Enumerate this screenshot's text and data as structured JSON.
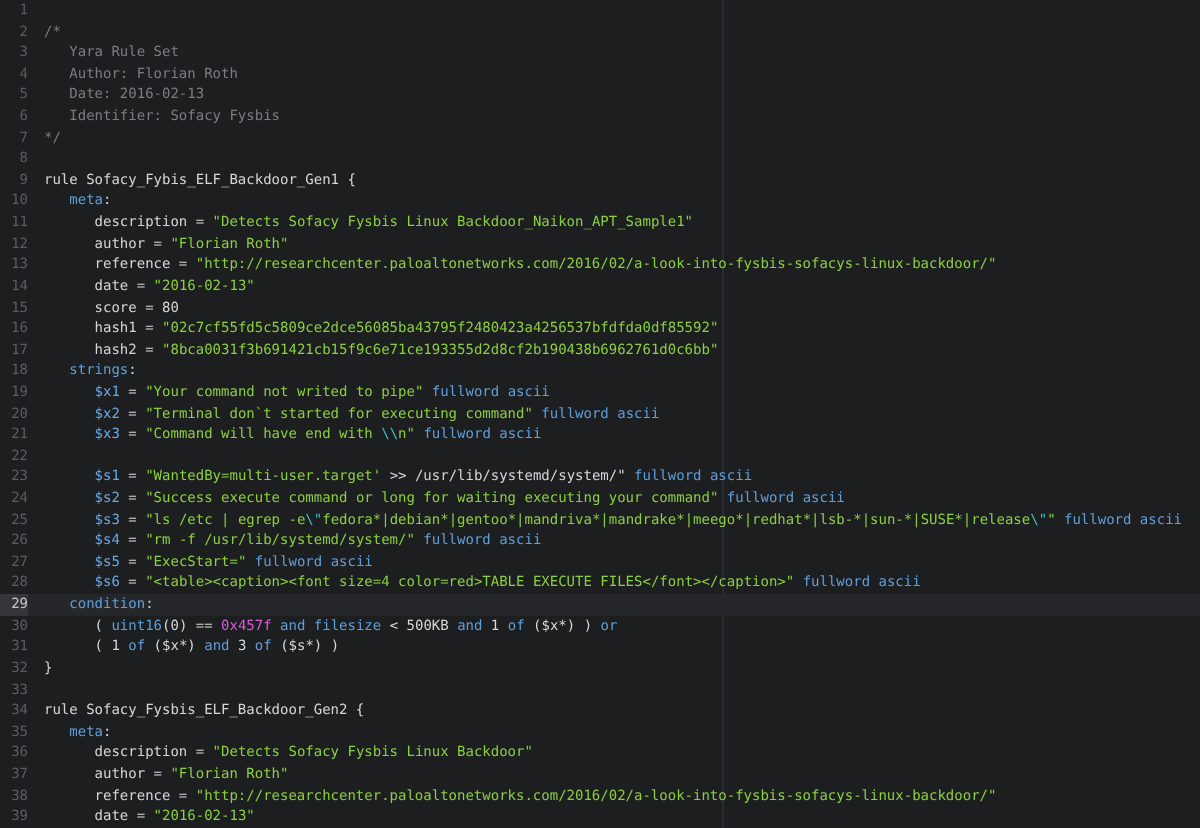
{
  "editor": {
    "lines": [
      {
        "number": "1",
        "selected": false
      },
      {
        "number": "2",
        "selected": false,
        "tokens": [
          {
            "kind": "comment",
            "text": "/*"
          }
        ]
      },
      {
        "number": "3",
        "selected": false,
        "tokens": [
          {
            "kind": "comment",
            "text": "   Yara Rule Set"
          }
        ]
      },
      {
        "number": "4",
        "selected": false,
        "tokens": [
          {
            "kind": "comment",
            "text": "   Author: Florian Roth"
          }
        ]
      },
      {
        "number": "5",
        "selected": false,
        "tokens": [
          {
            "kind": "comment",
            "text": "   Date: 2016-02-13"
          }
        ]
      },
      {
        "number": "6",
        "selected": false,
        "tokens": [
          {
            "kind": "comment",
            "text": "   Identifier: Sofacy Fysbis"
          }
        ]
      },
      {
        "number": "7",
        "selected": false,
        "tokens": [
          {
            "kind": "comment",
            "text": "*/"
          }
        ]
      },
      {
        "number": "8",
        "selected": false
      },
      {
        "number": "9",
        "selected": false,
        "tokens": [
          {
            "kind": "plain",
            "text": "rule Sofacy_Fybis_ELF_Backdoor_Gen1 {"
          }
        ]
      },
      {
        "number": "10",
        "selected": false,
        "tokens": [
          {
            "kind": "keyword",
            "text": "   meta"
          },
          {
            "kind": "plain",
            "text": ":"
          }
        ]
      },
      {
        "number": "11",
        "selected": false,
        "tokens": [
          {
            "kind": "plain",
            "text": "      description = "
          },
          {
            "kind": "string",
            "text": "\"Detects Sofacy Fysbis Linux Backdoor_Naikon_APT_Sample1\""
          }
        ]
      },
      {
        "number": "12",
        "selected": false,
        "tokens": [
          {
            "kind": "plain",
            "text": "      author = "
          },
          {
            "kind": "string",
            "text": "\"Florian Roth\""
          }
        ]
      },
      {
        "number": "13",
        "selected": false,
        "tokens": [
          {
            "kind": "plain",
            "text": "      reference = "
          },
          {
            "kind": "string",
            "text": "\"http://researchcenter.paloaltonetworks.com/2016/02/a-look-into-fysbis-sofacys-linux-backdoor/\""
          }
        ]
      },
      {
        "number": "14",
        "selected": false,
        "tokens": [
          {
            "kind": "plain",
            "text": "      date = "
          },
          {
            "kind": "string",
            "text": "\"2016-02-13\""
          }
        ]
      },
      {
        "number": "15",
        "selected": false,
        "tokens": [
          {
            "kind": "plain",
            "text": "      score = 80"
          }
        ]
      },
      {
        "number": "16",
        "selected": false,
        "tokens": [
          {
            "kind": "plain",
            "text": "      hash1 = "
          },
          {
            "kind": "string",
            "text": "\"02c7cf55fd5c5809ce2dce56085ba43795f2480423a4256537bfdfda0df85592\""
          }
        ]
      },
      {
        "number": "17",
        "selected": false,
        "tokens": [
          {
            "kind": "plain",
            "text": "      hash2 = "
          },
          {
            "kind": "string",
            "text": "\"8bca0031f3b691421cb15f9c6e71ce193355d2d8cf2b190438b6962761d0c6bb\""
          }
        ]
      },
      {
        "number": "18",
        "selected": false,
        "tokens": [
          {
            "kind": "keyword",
            "text": "   strings"
          },
          {
            "kind": "plain",
            "text": ":"
          }
        ]
      },
      {
        "number": "19",
        "selected": false,
        "tokens": [
          {
            "kind": "variable",
            "text": "      $x1"
          },
          {
            "kind": "plain",
            "text": " = "
          },
          {
            "kind": "string",
            "text": "\"Your command not writed to pipe\""
          },
          {
            "kind": "keyword",
            "text": " fullword ascii"
          }
        ]
      },
      {
        "number": "20",
        "selected": false,
        "tokens": [
          {
            "kind": "variable",
            "text": "      $x2"
          },
          {
            "kind": "plain",
            "text": " = "
          },
          {
            "kind": "string",
            "text": "\"Terminal don`t started for executing command\""
          },
          {
            "kind": "keyword",
            "text": " fullword ascii"
          }
        ]
      },
      {
        "number": "21",
        "selected": false,
        "tokens": [
          {
            "kind": "variable",
            "text": "      $x3"
          },
          {
            "kind": "plain",
            "text": " = "
          },
          {
            "kind": "string",
            "text": "\"Command will have end with "
          },
          {
            "kind": "escape",
            "text": "\\\\"
          },
          {
            "kind": "string",
            "text": "n\""
          },
          {
            "kind": "keyword",
            "text": " fullword ascii"
          }
        ]
      },
      {
        "number": "22",
        "selected": false
      },
      {
        "number": "23",
        "selected": false,
        "tokens": [
          {
            "kind": "variable",
            "text": "      $s1"
          },
          {
            "kind": "plain",
            "text": " = "
          },
          {
            "kind": "string",
            "text": "\"WantedBy=multi-user.target'"
          },
          {
            "kind": "plain",
            "text": " >> /usr/lib/systemd/system/\""
          },
          {
            "kind": "keyword",
            "text": " fullword ascii"
          }
        ]
      },
      {
        "number": "24",
        "selected": false,
        "tokens": [
          {
            "kind": "variable",
            "text": "      $s2"
          },
          {
            "kind": "plain",
            "text": " = "
          },
          {
            "kind": "string",
            "text": "\"Success execute command or long for waiting executing your command\""
          },
          {
            "kind": "keyword",
            "text": " fullword ascii"
          }
        ]
      },
      {
        "number": "25",
        "selected": false,
        "tokens": [
          {
            "kind": "variable",
            "text": "      $s3"
          },
          {
            "kind": "plain",
            "text": " = "
          },
          {
            "kind": "string",
            "text": "\"ls /etc | egrep -e"
          },
          {
            "kind": "escape",
            "text": "\\\""
          },
          {
            "kind": "string",
            "text": "fedora*|debian*|gentoo*|mandriva*|mandrake*|meego*|redhat*|lsb-*|sun-*|SUSE*|release"
          },
          {
            "kind": "escape",
            "text": "\\\""
          },
          {
            "kind": "string",
            "text": "\""
          },
          {
            "kind": "keyword",
            "text": " fullword ascii"
          }
        ]
      },
      {
        "number": "26",
        "selected": false,
        "tokens": [
          {
            "kind": "variable",
            "text": "      $s4"
          },
          {
            "kind": "plain",
            "text": " = "
          },
          {
            "kind": "string",
            "text": "\"rm -f /usr/lib/systemd/system/\""
          },
          {
            "kind": "keyword",
            "text": " fullword ascii"
          }
        ]
      },
      {
        "number": "27",
        "selected": false,
        "tokens": [
          {
            "kind": "variable",
            "text": "      $s5"
          },
          {
            "kind": "plain",
            "text": " = "
          },
          {
            "kind": "string",
            "text": "\"ExecStart=\""
          },
          {
            "kind": "keyword",
            "text": " fullword ascii"
          }
        ]
      },
      {
        "number": "28",
        "selected": false,
        "tokens": [
          {
            "kind": "variable",
            "text": "      $s6"
          },
          {
            "kind": "plain",
            "text": " = "
          },
          {
            "kind": "string",
            "text": "\"<table><caption><font size=4 color=red>TABLE EXECUTE FILES</font></caption>\""
          },
          {
            "kind": "keyword",
            "text": " fullword ascii"
          }
        ]
      },
      {
        "number": "29",
        "selected": true,
        "tokens": [
          {
            "kind": "keyword",
            "text": "   condition"
          },
          {
            "kind": "plain",
            "text": ":"
          }
        ]
      },
      {
        "number": "30",
        "selected": false,
        "tokens": [
          {
            "kind": "plain",
            "text": "      ( "
          },
          {
            "kind": "keyword",
            "text": "uint16"
          },
          {
            "kind": "plain",
            "text": "(0) == "
          },
          {
            "kind": "hex",
            "text": "0x457f"
          },
          {
            "kind": "keyword",
            "text": " and filesize"
          },
          {
            "kind": "plain",
            "text": " < 500KB "
          },
          {
            "kind": "keyword",
            "text": "and"
          },
          {
            "kind": "plain",
            "text": " 1 "
          },
          {
            "kind": "keyword",
            "text": "of"
          },
          {
            "kind": "plain",
            "text": " ($x*) ) "
          },
          {
            "kind": "keyword",
            "text": "or"
          }
        ]
      },
      {
        "number": "31",
        "selected": false,
        "tokens": [
          {
            "kind": "plain",
            "text": "      ( 1 "
          },
          {
            "kind": "keyword",
            "text": "of"
          },
          {
            "kind": "plain",
            "text": " ($x*) "
          },
          {
            "kind": "keyword",
            "text": "and"
          },
          {
            "kind": "plain",
            "text": " 3 "
          },
          {
            "kind": "keyword",
            "text": "of"
          },
          {
            "kind": "plain",
            "text": " ($s*) )"
          }
        ]
      },
      {
        "number": "32",
        "selected": false,
        "tokens": [
          {
            "kind": "plain",
            "text": "}"
          }
        ]
      },
      {
        "number": "33",
        "selected": false
      },
      {
        "number": "34",
        "selected": false,
        "tokens": [
          {
            "kind": "plain",
            "text": "rule Sofacy_Fysbis_ELF_Backdoor_Gen2 {"
          }
        ]
      },
      {
        "number": "35",
        "selected": false,
        "tokens": [
          {
            "kind": "keyword",
            "text": "   meta"
          },
          {
            "kind": "plain",
            "text": ":"
          }
        ]
      },
      {
        "number": "36",
        "selected": false,
        "tokens": [
          {
            "kind": "plain",
            "text": "      description = "
          },
          {
            "kind": "string",
            "text": "\"Detects Sofacy Fysbis Linux Backdoor\""
          }
        ]
      },
      {
        "number": "37",
        "selected": false,
        "tokens": [
          {
            "kind": "plain",
            "text": "      author = "
          },
          {
            "kind": "string",
            "text": "\"Florian Roth\""
          }
        ]
      },
      {
        "number": "38",
        "selected": false,
        "tokens": [
          {
            "kind": "plain",
            "text": "      reference = "
          },
          {
            "kind": "string",
            "text": "\"http://researchcenter.paloaltonetworks.com/2016/02/a-look-into-fysbis-sofacys-linux-backdoor/\""
          }
        ]
      },
      {
        "number": "39",
        "selected": false,
        "tokens": [
          {
            "kind": "plain",
            "text": "      date = "
          },
          {
            "kind": "string",
            "text": "\"2016-02-13\""
          }
        ]
      }
    ]
  }
}
